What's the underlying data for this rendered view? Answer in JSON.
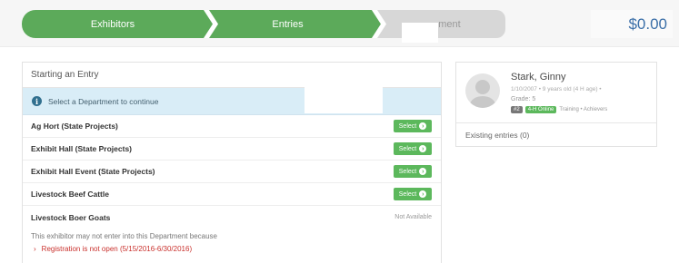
{
  "steps": {
    "step1": "Exhibitors",
    "step2": "Entries",
    "step3_visible": "ment"
  },
  "cart_total": "$0.00",
  "panel": {
    "heading": "Starting an Entry",
    "alert": "Select a Department to continue"
  },
  "departments": [
    {
      "name": "Ag Hort (State Projects)",
      "action": "Select"
    },
    {
      "name": "Exhibit Hall (State Projects)",
      "action": "Select"
    },
    {
      "name": "Exhibit Hall Event (State Projects)",
      "action": "Select"
    },
    {
      "name": "Livestock Beef Cattle",
      "action": "Select"
    },
    {
      "name": "Livestock Boer Goats",
      "action": "Not Available"
    }
  ],
  "ineligible_message": "This exhibitor may not enter into this Department because",
  "ineligible_reason": "Registration is not open (5/15/2016-6/30/2016)",
  "exhibitor": {
    "name": "Stark, Ginny",
    "meta": "1/10/2007 • 9 years old (4 H age) •",
    "grade": "Grade: 5",
    "tag_number": "#2",
    "tag_club": "4-H Online",
    "tag_text": "Training • Achievers",
    "existing_entries": "Existing entries (0)"
  },
  "colors": {
    "step_active": "#5caa5a",
    "step_inactive": "#d7d7d7",
    "total": "#3b6fa8",
    "alert_bg": "#d9edf7",
    "select_button": "#5cb85c",
    "error_text": "#c9302c"
  }
}
